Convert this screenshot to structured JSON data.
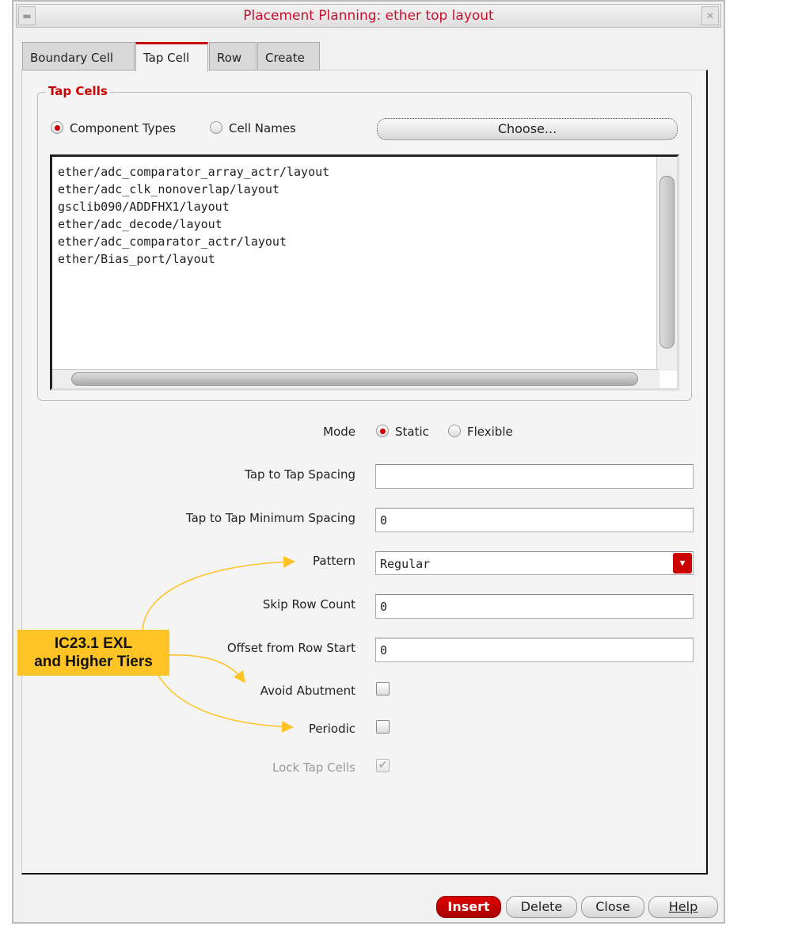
{
  "window": {
    "title": "Placement Planning: ether top layout"
  },
  "tabs": [
    {
      "label": "Boundary Cell"
    },
    {
      "label": "Tap Cell"
    },
    {
      "label": "Row"
    },
    {
      "label": "Create"
    }
  ],
  "tap_cells": {
    "title": "Tap Cells",
    "radio_component_types": "Component Types",
    "radio_cell_names": "Cell Names",
    "choose_label": "Choose...",
    "items": [
      "ether/adc_comparator_array_actr/layout",
      "ether/adc_clk_nonoverlap/layout",
      "gsclib090/ADDFHX1/layout",
      "ether/adc_decode/layout",
      "ether/adc_comparator_actr/layout",
      "ether/Bias_port/layout"
    ]
  },
  "form": {
    "mode_label": "Mode",
    "mode_static": "Static",
    "mode_flexible": "Flexible",
    "spacing_label": "Tap to Tap Spacing",
    "spacing_value": "",
    "min_spacing_label": "Tap to Tap Minimum Spacing",
    "min_spacing_value": "0",
    "pattern_label": "Pattern",
    "pattern_value": "Regular",
    "skip_label": "Skip Row Count",
    "skip_value": "0",
    "offset_label": "Offset from Row Start",
    "offset_value": "0",
    "avoid_label": "Avoid Abutment",
    "periodic_label": "Periodic",
    "lock_label": "Lock Tap Cells"
  },
  "annotation": {
    "line1": "IC23.1 EXL",
    "line2": "and Higher Tiers",
    "color": "#fec425"
  },
  "buttons": {
    "insert": "Insert",
    "delete": "Delete",
    "close": "Close",
    "help": "Help"
  }
}
